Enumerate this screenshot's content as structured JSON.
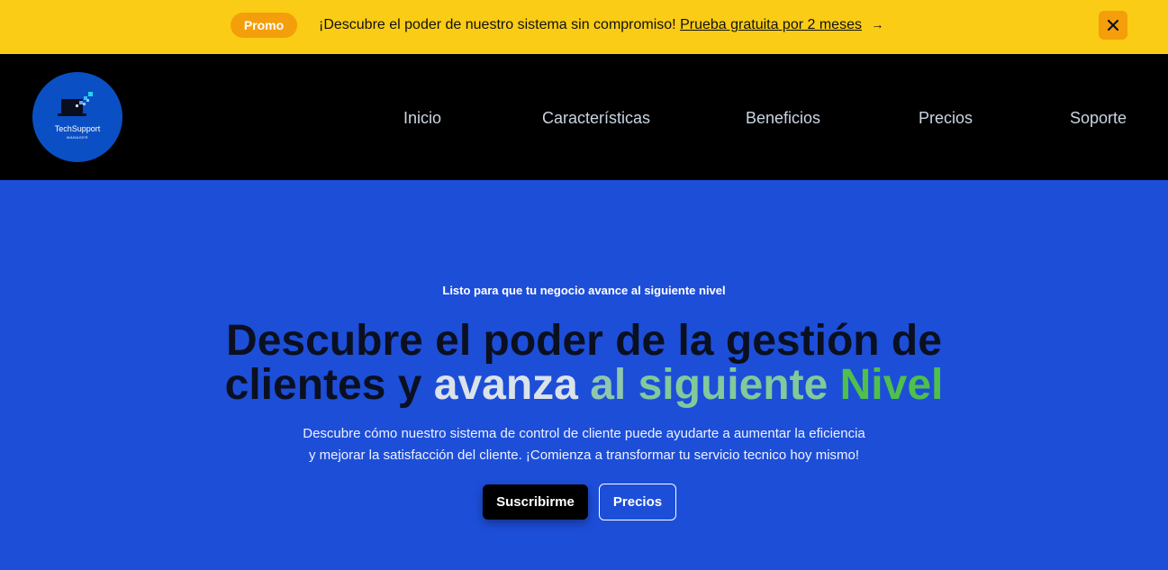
{
  "promo": {
    "badge": "Promo",
    "message": "¡Descubre el poder de nuestro sistema sin compromiso!",
    "link_text": "Prueba gratuita por 2 meses",
    "arrow": "→",
    "close_icon": "close-icon"
  },
  "header": {
    "logo_name": "TechSupport",
    "logo_sub": "MANAGER",
    "nav": [
      {
        "label": "Inicio"
      },
      {
        "label": "Características"
      },
      {
        "label": "Beneficios"
      },
      {
        "label": "Precios"
      },
      {
        "label": "Soporte"
      }
    ]
  },
  "hero": {
    "eyebrow": "Listo para que tu negocio avance al siguiente nivel",
    "title_line1": "Descubre el poder de la gestión de",
    "title_line2_dark": "clientes y",
    "title_word_avanza": "avanza",
    "title_word_al": "al",
    "title_word_siguiente": "siguiente",
    "title_word_nivel": "Nivel",
    "desc_line1": "Descubre cómo nuestro sistema de control de cliente puede ayudarte a aumentar la eficiencia",
    "desc_line2": "y mejorar la satisfacción del cliente. ¡Comienza a transformar tu servicio tecnico hoy mismo!",
    "primary_button": "Suscribirme",
    "secondary_button": "Precios"
  },
  "colors": {
    "promo_bg": "#facc15",
    "accent_orange": "#f59e0b",
    "hero_bg": "#1d4ed8",
    "header_bg": "#000000",
    "nivel_green": "#4fc04a"
  }
}
